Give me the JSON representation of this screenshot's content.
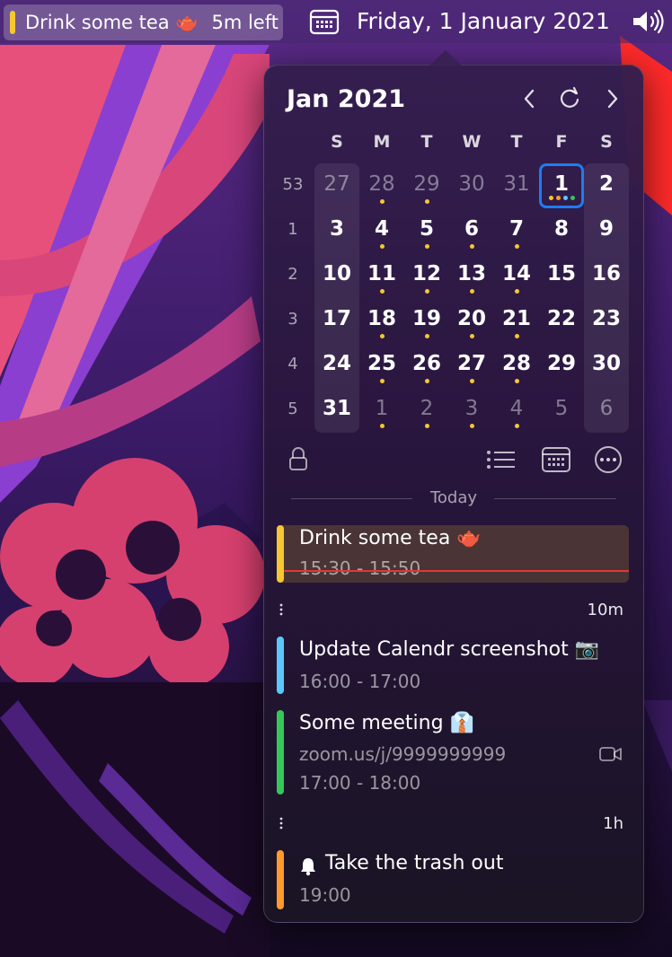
{
  "menubar": {
    "event_title": "Drink some tea 🫖",
    "event_remaining": "5m left",
    "event_color": "#f5c730",
    "calendar_icon": "calendar-icon",
    "date": "Friday, 1 January 2021",
    "volume_icon": "volume-icon"
  },
  "calendar": {
    "title": "Jan 2021",
    "nav": {
      "prev_icon": "chevron-left-icon",
      "refresh_icon": "refresh-icon",
      "next_icon": "chevron-right-icon"
    },
    "weekdays": [
      "S",
      "M",
      "T",
      "W",
      "T",
      "F",
      "S"
    ],
    "week_numbers": [
      "53",
      "1",
      "2",
      "3",
      "4",
      "5"
    ],
    "weeks": [
      [
        {
          "d": "27",
          "dim": true,
          "dots": []
        },
        {
          "d": "28",
          "dim": true,
          "dots": [
            "#f5c730"
          ]
        },
        {
          "d": "29",
          "dim": true,
          "dots": [
            "#f5c730"
          ]
        },
        {
          "d": "30",
          "dim": true,
          "dots": []
        },
        {
          "d": "31",
          "dim": true,
          "dots": []
        },
        {
          "d": "1",
          "today": true,
          "dots": [
            "#f5c730",
            "#ff9a2e",
            "#5ac8fa",
            "#34c759"
          ]
        },
        {
          "d": "2",
          "dots": []
        }
      ],
      [
        {
          "d": "3",
          "dots": []
        },
        {
          "d": "4",
          "dots": [
            "#f5c730"
          ]
        },
        {
          "d": "5",
          "dots": [
            "#f5c730"
          ]
        },
        {
          "d": "6",
          "dots": [
            "#f5c730"
          ]
        },
        {
          "d": "7",
          "dots": [
            "#f5c730"
          ]
        },
        {
          "d": "8",
          "dots": []
        },
        {
          "d": "9",
          "dots": []
        }
      ],
      [
        {
          "d": "10",
          "dots": []
        },
        {
          "d": "11",
          "dots": [
            "#f5c730"
          ]
        },
        {
          "d": "12",
          "dots": [
            "#f5c730"
          ]
        },
        {
          "d": "13",
          "dots": [
            "#f5c730"
          ]
        },
        {
          "d": "14",
          "dots": [
            "#f5c730"
          ]
        },
        {
          "d": "15",
          "dots": []
        },
        {
          "d": "16",
          "dots": []
        }
      ],
      [
        {
          "d": "17",
          "dots": []
        },
        {
          "d": "18",
          "dots": [
            "#f5c730"
          ]
        },
        {
          "d": "19",
          "dots": [
            "#f5c730"
          ]
        },
        {
          "d": "20",
          "dots": [
            "#f5c730"
          ]
        },
        {
          "d": "21",
          "dots": [
            "#f5c730"
          ]
        },
        {
          "d": "22",
          "dots": []
        },
        {
          "d": "23",
          "dots": []
        }
      ],
      [
        {
          "d": "24",
          "dots": []
        },
        {
          "d": "25",
          "dots": [
            "#f5c730"
          ]
        },
        {
          "d": "26",
          "dots": [
            "#f5c730"
          ]
        },
        {
          "d": "27",
          "dots": [
            "#f5c730"
          ]
        },
        {
          "d": "28",
          "dots": [
            "#f5c730"
          ]
        },
        {
          "d": "29",
          "dots": []
        },
        {
          "d": "30",
          "dots": []
        }
      ],
      [
        {
          "d": "31",
          "dots": []
        },
        {
          "d": "1",
          "dim": true,
          "dots": [
            "#f5c730"
          ]
        },
        {
          "d": "2",
          "dim": true,
          "dots": [
            "#f5c730"
          ]
        },
        {
          "d": "3",
          "dim": true,
          "dots": [
            "#f5c730"
          ]
        },
        {
          "d": "4",
          "dim": true,
          "dots": [
            "#f5c730"
          ]
        },
        {
          "d": "5",
          "dim": true,
          "dots": []
        },
        {
          "d": "6",
          "dim": true,
          "dots": []
        }
      ]
    ],
    "toolbar": {
      "lock_icon": "lock-icon",
      "list_icon": "list-icon",
      "calendar_icon": "calendar-grid-icon",
      "more_icon": "ellipsis-circle-icon"
    }
  },
  "agenda": {
    "section_label": "Today",
    "events": [
      {
        "title": "Drink some tea 🫖",
        "time": "15:30 - 15:50",
        "color": "#f5c730",
        "current": true
      },
      {
        "title": "Update Calendr screenshot 📷",
        "time": "16:00 - 17:00",
        "color": "#5ac8fa"
      },
      {
        "title": "Some meeting 👔",
        "link": "zoom.us/j/9999999999",
        "time": "17:00 - 18:00",
        "color": "#34c759",
        "link_icon": "video-camera-icon"
      },
      {
        "title": "Take the trash out",
        "time": "19:00",
        "color": "#ff9a2e",
        "reminder_icon": "bell-icon"
      }
    ],
    "gaps": [
      "10m",
      "1h"
    ],
    "gap_icon": "vertical-ellipsis-icon"
  },
  "colors": {
    "today_ring": "#1e7cf2",
    "now_line": "#e0373a"
  }
}
